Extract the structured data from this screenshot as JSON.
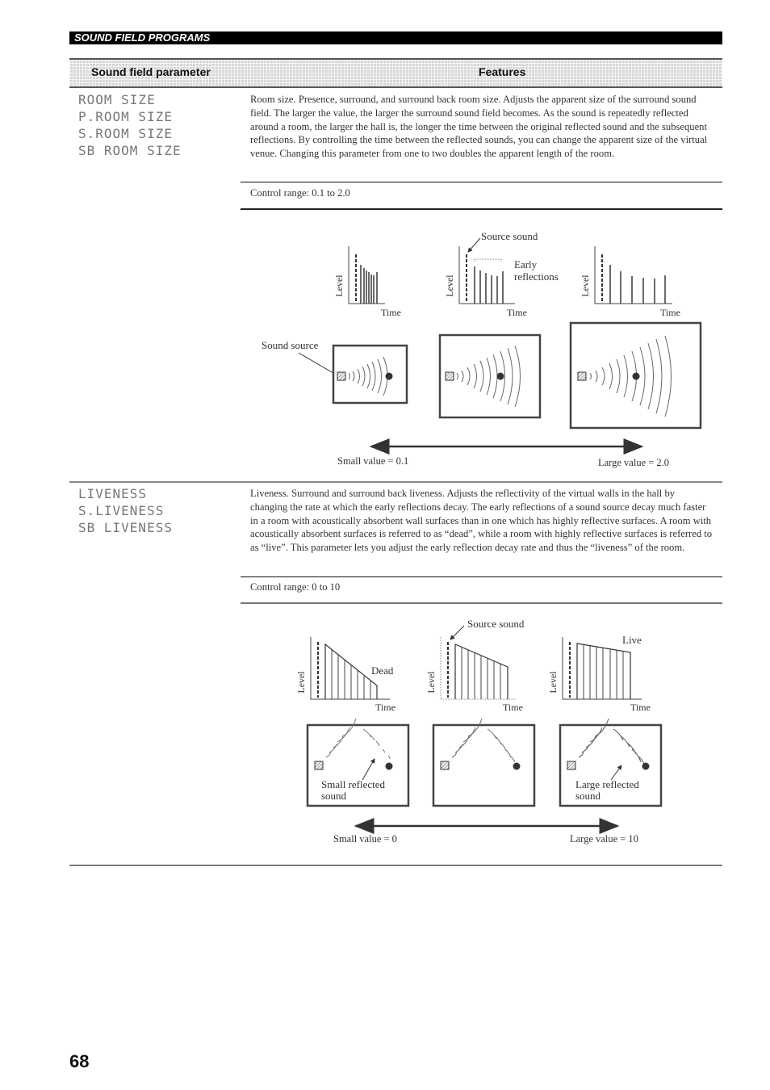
{
  "header": {
    "section_title": "SOUND FIELD PROGRAMS"
  },
  "table_header": {
    "col1": "Sound field parameter",
    "col2": "Features"
  },
  "rows": [
    {
      "params": [
        "ROOM SIZE",
        "P.ROOM SIZE",
        "S.ROOM SIZE",
        "SB ROOM SIZE"
      ],
      "description": "Room size. Presence, surround, and surround back room size. Adjusts the apparent size of the surround sound field. The larger the value, the larger the surround sound field becomes. As the sound is repeatedly reflected around a room, the larger the hall is, the longer the time between the original reflected sound and the subsequent reflections. By controlling the time between the reflected sounds, you can change the apparent size of the virtual venue. Changing this parameter from one to two doubles the apparent length of the room.",
      "control_range": "Control range: 0.1 to 2.0",
      "figure": {
        "source_sound_label": "Source sound",
        "early_reflections_label_1": "Early",
        "early_reflections_label_2": "reflections",
        "y_axis_label": "Level",
        "x_axis_label": "Time",
        "sound_source_label": "Sound source",
        "small_value_label": "Small value = 0.1",
        "large_value_label": "Large value = 2.0"
      }
    },
    {
      "params": [
        "LIVENESS",
        "S.LIVENESS",
        "SB LIVENESS"
      ],
      "description": "Liveness. Surround and surround back liveness. Adjusts the reflectivity of the virtual walls in the hall by changing the rate at which the early reflections decay. The early reflections of a sound source decay much faster in a room with acoustically absorbent wall surfaces than in one which has highly reflective surfaces. A room with acoustically absorbent surfaces is referred to as “dead”, while a room with highly reflective surfaces is referred to as “live”. This parameter lets you adjust the early reflection decay rate and thus the “liveness” of the room.",
      "control_range": "Control range: 0 to 10",
      "figure": {
        "source_sound_label": "Source sound",
        "dead_label": "Dead",
        "live_label": "Live",
        "y_axis_label": "Level",
        "x_axis_label": "Time",
        "small_reflected_label_1": "Small reflected",
        "small_reflected_label_2": "sound",
        "large_reflected_label_1": "Large reflected",
        "large_reflected_label_2": "sound",
        "small_value_label": "Small value = 0",
        "large_value_label": "Large value = 10"
      }
    }
  ],
  "page_number": "68"
}
